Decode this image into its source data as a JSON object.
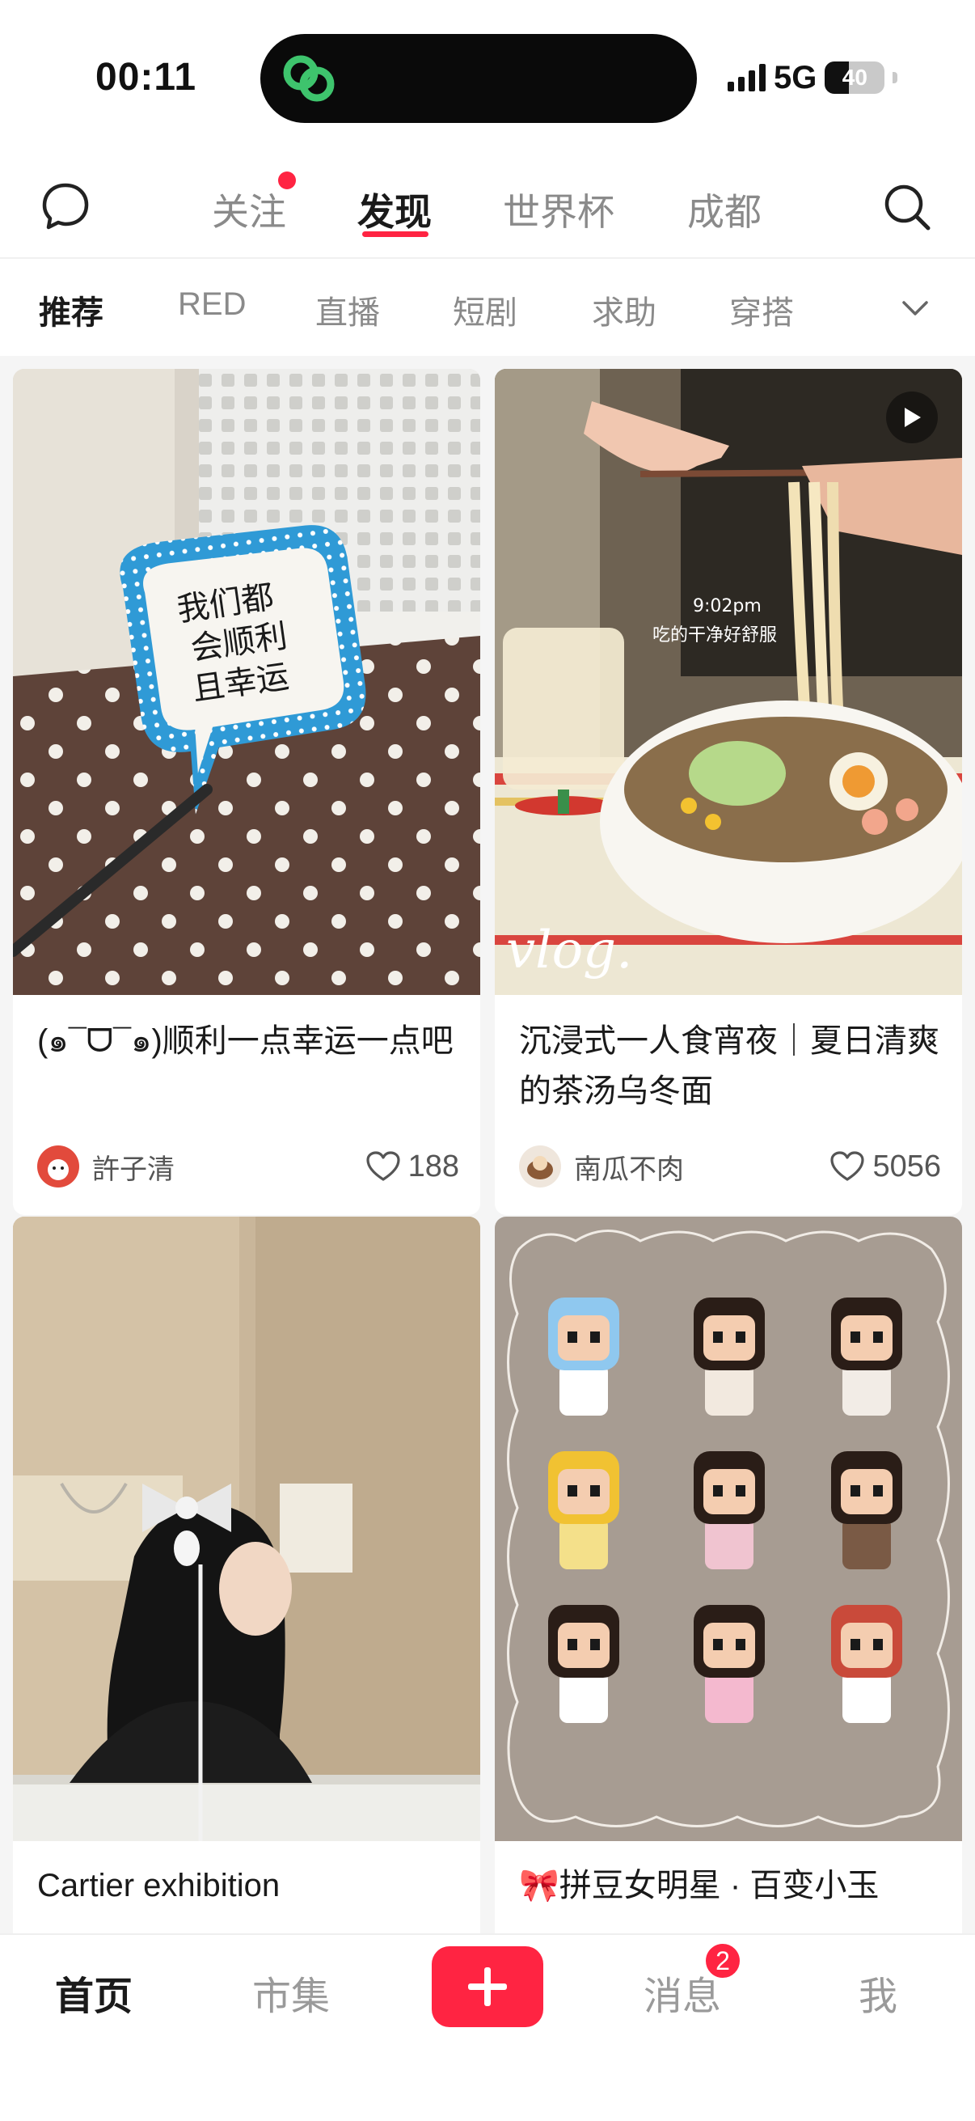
{
  "status_bar": {
    "time": "00:11",
    "network": "5G",
    "battery_level": "40",
    "battery_fraction": 0.4
  },
  "top_nav": {
    "tabs": [
      {
        "label": "关注",
        "has_dot": true
      },
      {
        "label": "发现",
        "active": true
      },
      {
        "label": "世界杯"
      },
      {
        "label": "成都"
      }
    ]
  },
  "categories": {
    "items": [
      "推荐",
      "RED",
      "直播",
      "短剧",
      "求助",
      "穿搭"
    ],
    "active_index": 0
  },
  "feed": {
    "cards": [
      {
        "title": "(๑¯ᗜ¯๑)顺利一点幸运一点吧",
        "author": "許子清",
        "likes": "188",
        "image_text": [
          "我们都",
          "会顺利",
          "且幸运"
        ],
        "is_video": false
      },
      {
        "title": "沉浸式一人食宵夜｜夏日清爽的茶汤乌冬面",
        "author": "南瓜不肉",
        "likes": "5056",
        "image_text": [
          "9:02pm",
          "吃的干净好舒服",
          "vlog."
        ],
        "is_video": true
      },
      {
        "title": "Cartier exhibition",
        "is_video": false
      },
      {
        "title": "🎀拼豆女明星 · 百变小玉",
        "is_video": false
      }
    ]
  },
  "tab_bar": {
    "home": "首页",
    "market": "市集",
    "messages": "消息",
    "messages_badge": "2",
    "me": "我"
  },
  "colors": {
    "accent": "#ff2442",
    "active_text": "#1a1a1a",
    "inactive_text": "#8a8a8a",
    "feed_background": "#f5f5f5"
  }
}
